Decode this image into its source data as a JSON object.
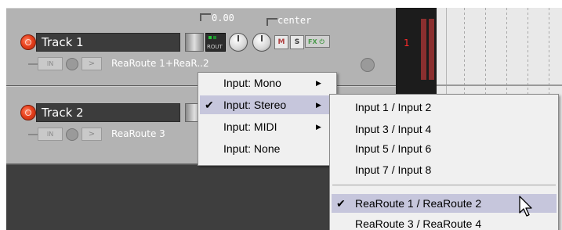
{
  "colors": {
    "tcp_bg": "#b3b3b3",
    "rec": "#e8401c",
    "menu_bg": "#f0f0f0",
    "menu_hover": "#c6c6dc",
    "meter": "#8a2f2f"
  },
  "header": {
    "volume_readout": "0.00",
    "pan_readout": "center"
  },
  "tracks": [
    {
      "name": "Track 1",
      "input": "ReaRoute 1+ReaR..2",
      "number": "1",
      "in_button": "IN"
    },
    {
      "name": "Track 2",
      "input": "ReaRoute 3",
      "in_button": "IN"
    }
  ],
  "track_buttons": {
    "route": "ROUT",
    "mute": "M",
    "solo": "S",
    "fx": "FX"
  },
  "input_menu": {
    "items": [
      {
        "label": "Input: Mono",
        "checked": false,
        "has_submenu": true
      },
      {
        "label": "Input: Stereo",
        "checked": true,
        "has_submenu": true,
        "highlighted": true
      },
      {
        "label": "Input: MIDI",
        "checked": false,
        "has_submenu": true
      },
      {
        "label": "Input: None",
        "checked": false,
        "has_submenu": false
      }
    ]
  },
  "stereo_submenu": {
    "items": [
      {
        "label": "Input 1 / Input 2"
      },
      {
        "label": "Input 3 / Input 4"
      },
      {
        "label": "Input 5 / Input 6"
      },
      {
        "label": "Input 7 / Input 8"
      },
      {
        "label": "ReaRoute 1 / ReaRoute 2",
        "checked": true,
        "highlighted": true
      },
      {
        "label": "ReaRoute 3 / ReaRoute 4"
      }
    ]
  },
  "glyphs": {
    "check": "✔",
    "submenu_arrow": "▶"
  }
}
